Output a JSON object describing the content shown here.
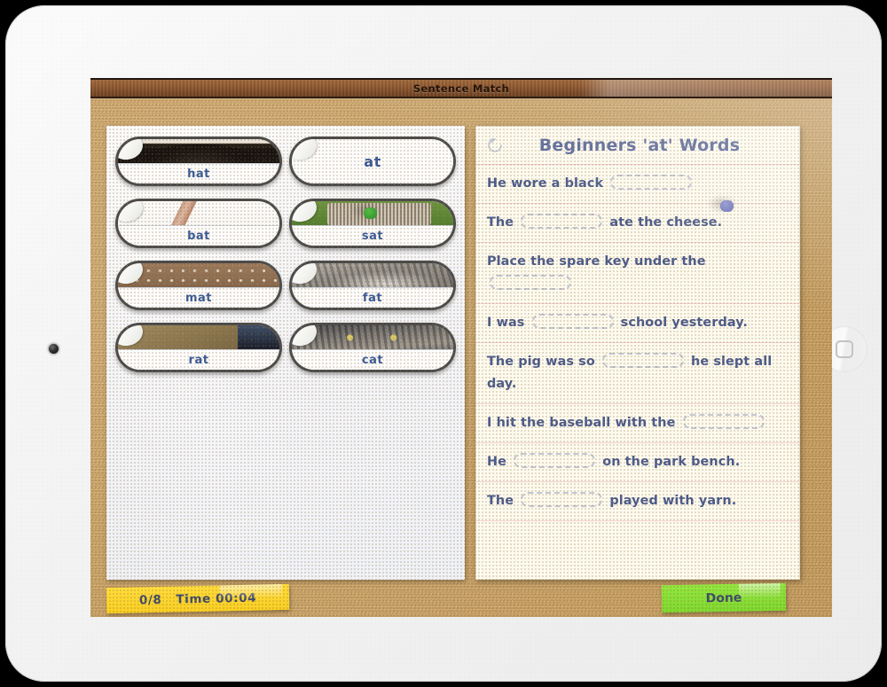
{
  "app": {
    "window_title": "Sentence Match"
  },
  "left_panel": {
    "pin_icon": "green-pushpin-icon",
    "tiles": [
      {
        "word": "hat",
        "image": "black-hat-photo",
        "blank": false
      },
      {
        "word": "at",
        "image": "none",
        "blank": true
      },
      {
        "word": "bat",
        "image": "baseball-bat-photo",
        "blank": false
      },
      {
        "word": "sat",
        "image": "park-bench-photo",
        "blank": false
      },
      {
        "word": "mat",
        "image": "door-mat-photo",
        "blank": false
      },
      {
        "word": "fat",
        "image": "fat-cat-photo",
        "blank": false
      },
      {
        "word": "rat",
        "image": "rat-photo",
        "blank": false
      },
      {
        "word": "cat",
        "image": "cat-face-photo",
        "blank": false
      }
    ]
  },
  "right_panel": {
    "pin_icon": "purple-pushpin-icon",
    "reset_icon": "refresh-circular-arrow-icon",
    "title": "Beginners 'at' Words",
    "sentences": [
      {
        "before": "He wore a black ",
        "after": ""
      },
      {
        "before": "The ",
        "after": " ate the cheese."
      },
      {
        "before": "Place the spare key under the ",
        "after": ""
      },
      {
        "before": "I was ",
        "after": " school yesterday."
      },
      {
        "before": "The pig was so ",
        "after": " he slept all day."
      },
      {
        "before": "I hit the baseball with the ",
        "after": ""
      },
      {
        "before": "He ",
        "after": " on the park bench."
      },
      {
        "before": "The ",
        "after": " played with yarn."
      }
    ]
  },
  "footer": {
    "score": "0/8",
    "time": "Time 00:04",
    "done_label": "Done"
  },
  "device": {
    "camera_icon": "camera-lens-icon",
    "home_icon": "home-button-icon"
  },
  "colors": {
    "word_blue": "#3a5a96",
    "title_blue": "#5a6898",
    "sticky_yellow": "#ffdc3c",
    "sticky_green": "#92e83f",
    "cork": "#cda668",
    "wood": "#8d5730"
  }
}
